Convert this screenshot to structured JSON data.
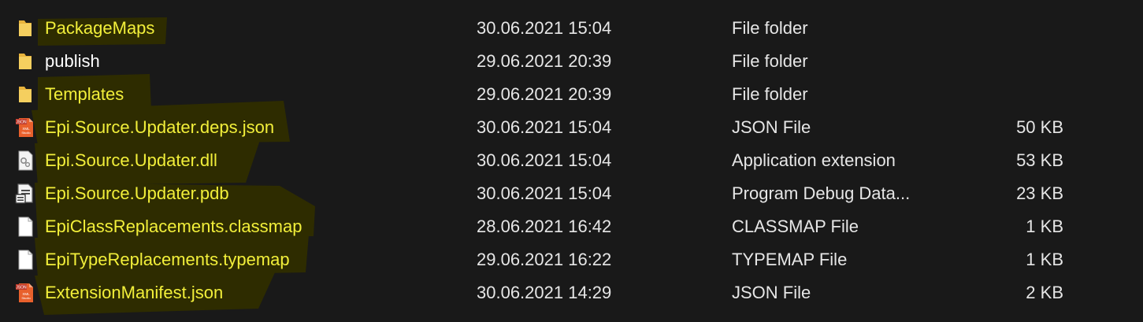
{
  "colors": {
    "background": "#191919",
    "highlight_marker": "#2e2c00",
    "highlight_text": "#f2ef3a",
    "text": "#e6e6e6",
    "folder_icon": "#f0c24b"
  },
  "files": [
    {
      "name": "PackageMaps",
      "date": "30.06.2021 15:04",
      "type": "File folder",
      "size": "",
      "icon": "folder-icon",
      "highlighted": true
    },
    {
      "name": "publish",
      "date": "29.06.2021 20:39",
      "type": "File folder",
      "size": "",
      "icon": "folder-icon",
      "highlighted": false
    },
    {
      "name": "Templates",
      "date": "29.06.2021 20:39",
      "type": "File folder",
      "size": "",
      "icon": "folder-icon",
      "highlighted": true
    },
    {
      "name": "Epi.Source.Updater.deps.json",
      "date": "30.06.2021 15:04",
      "type": "JSON File",
      "size": "50 KB",
      "icon": "json-file-icon",
      "highlighted": true
    },
    {
      "name": "Epi.Source.Updater.dll",
      "date": "30.06.2021 15:04",
      "type": "Application extension",
      "size": "53 KB",
      "icon": "dll-file-icon",
      "highlighted": true
    },
    {
      "name": "Epi.Source.Updater.pdb",
      "date": "30.06.2021 15:04",
      "type": "Program Debug Data...",
      "size": "23 KB",
      "icon": "pdb-file-icon",
      "highlighted": true
    },
    {
      "name": "EpiClassReplacements.classmap",
      "date": "28.06.2021 16:42",
      "type": "CLASSMAP File",
      "size": "1 KB",
      "icon": "blank-file-icon",
      "highlighted": true
    },
    {
      "name": "EpiTypeReplacements.typemap",
      "date": "29.06.2021 16:22",
      "type": "TYPEMAP File",
      "size": "1 KB",
      "icon": "blank-file-icon",
      "highlighted": true
    },
    {
      "name": "ExtensionManifest.json",
      "date": "30.06.2021 14:29",
      "type": "JSON File",
      "size": "2 KB",
      "icon": "json-file-icon",
      "highlighted": true
    }
  ]
}
